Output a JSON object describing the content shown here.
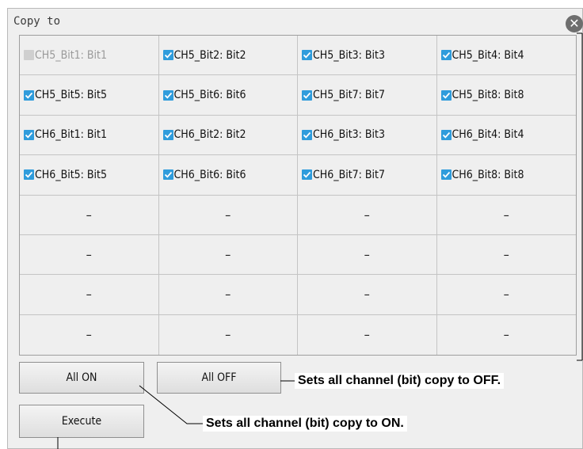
{
  "dialog": {
    "title": "Copy to",
    "close_icon": "close-icon"
  },
  "grid": {
    "cells": [
      {
        "label": "CH5_Bit1: Bit1",
        "checked": false,
        "disabled": true
      },
      {
        "label": "CH5_Bit2: Bit2",
        "checked": true,
        "disabled": false
      },
      {
        "label": "CH5_Bit3: Bit3",
        "checked": true,
        "disabled": false
      },
      {
        "label": "CH5_Bit4: Bit4",
        "checked": true,
        "disabled": false
      },
      {
        "label": "CH5_Bit5: Bit5",
        "checked": true,
        "disabled": false
      },
      {
        "label": "CH5_Bit6: Bit6",
        "checked": true,
        "disabled": false
      },
      {
        "label": "CH5_Bit7: Bit7",
        "checked": true,
        "disabled": false
      },
      {
        "label": "CH5_Bit8: Bit8",
        "checked": true,
        "disabled": false
      },
      {
        "label": "CH6_Bit1: Bit1",
        "checked": true,
        "disabled": false
      },
      {
        "label": "CH6_Bit2: Bit2",
        "checked": true,
        "disabled": false
      },
      {
        "label": "CH6_Bit3: Bit3",
        "checked": true,
        "disabled": false
      },
      {
        "label": "CH6_Bit4: Bit4",
        "checked": true,
        "disabled": false
      },
      {
        "label": "CH6_Bit5: Bit5",
        "checked": true,
        "disabled": false
      },
      {
        "label": "CH6_Bit6: Bit6",
        "checked": true,
        "disabled": false
      },
      {
        "label": "CH6_Bit7: Bit7",
        "checked": true,
        "disabled": false
      },
      {
        "label": "CH6_Bit8: Bit8",
        "checked": true,
        "disabled": false
      }
    ],
    "empty_label": "–",
    "empty_count": 16
  },
  "buttons": {
    "all_on": "All ON",
    "all_off": "All OFF",
    "execute": "Execute"
  },
  "callouts": {
    "all_off": "Sets all channel (bit) copy to OFF.",
    "all_on": "Sets all channel (bit) copy to ON."
  },
  "colors": {
    "checkbox_on": "#2f9cdc",
    "dialog_bg": "#efefef"
  }
}
